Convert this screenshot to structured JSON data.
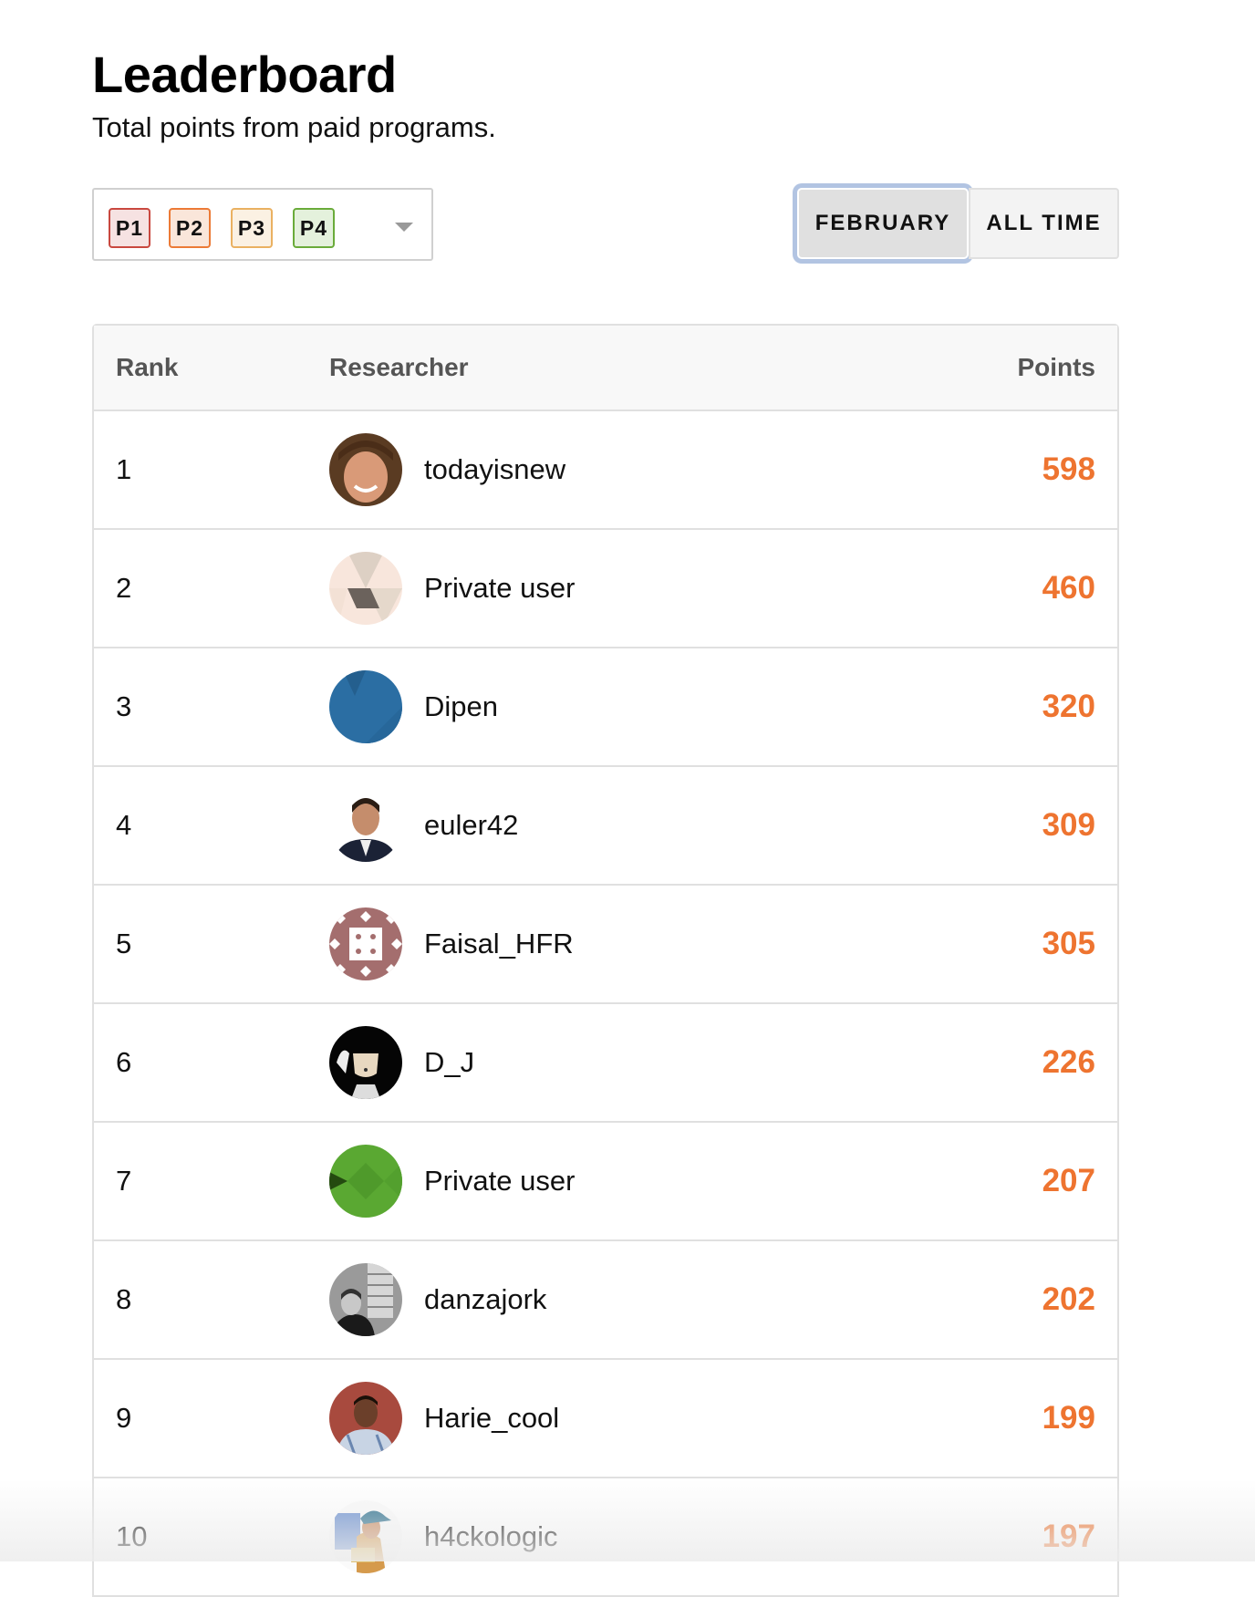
{
  "header": {
    "title": "Leaderboard",
    "subtitle": "Total points from paid programs."
  },
  "severity_filter": {
    "pills": [
      {
        "label": "P1",
        "border": "#c9483f",
        "bg": "#f6e2e2"
      },
      {
        "label": "P2",
        "border": "#ec7a36",
        "bg": "#fae6da"
      },
      {
        "label": "P3",
        "border": "#eab161",
        "bg": "#fbf1e3"
      },
      {
        "label": "P4",
        "border": "#6aab3a",
        "bg": "#e4f1dc"
      }
    ],
    "dropdown_icon": "caret-down-icon"
  },
  "period_toggle": {
    "options": [
      {
        "label": "FEBRUARY",
        "selected": true
      },
      {
        "label": "ALL TIME",
        "selected": false
      }
    ]
  },
  "table": {
    "columns": {
      "rank": "Rank",
      "researcher": "Researcher",
      "points": "Points"
    },
    "points_color": "#ee7430",
    "rows": [
      {
        "rank": "1",
        "name": "todayisnew",
        "points": "598",
        "avatar": "photo-curly-hair"
      },
      {
        "rank": "2",
        "name": "Private user",
        "points": "460",
        "avatar": "geometric-beige"
      },
      {
        "rank": "3",
        "name": "Dipen",
        "points": "320",
        "avatar": "geometric-blue"
      },
      {
        "rank": "4",
        "name": "euler42",
        "points": "309",
        "avatar": "photo-man-suit"
      },
      {
        "rank": "5",
        "name": "Faisal_HFR",
        "points": "305",
        "avatar": "pattern-mauve"
      },
      {
        "rank": "6",
        "name": "D_J",
        "points": "226",
        "avatar": "anime-black"
      },
      {
        "rank": "7",
        "name": "Private user",
        "points": "207",
        "avatar": "geometric-green"
      },
      {
        "rank": "8",
        "name": "danzajork",
        "points": "202",
        "avatar": "photo-bw"
      },
      {
        "rank": "9",
        "name": "Harie_cool",
        "points": "199",
        "avatar": "photo-red-bg"
      },
      {
        "rank": "10",
        "name": "h4ckologic",
        "points": "197",
        "avatar": "cartoon-cap"
      }
    ]
  }
}
